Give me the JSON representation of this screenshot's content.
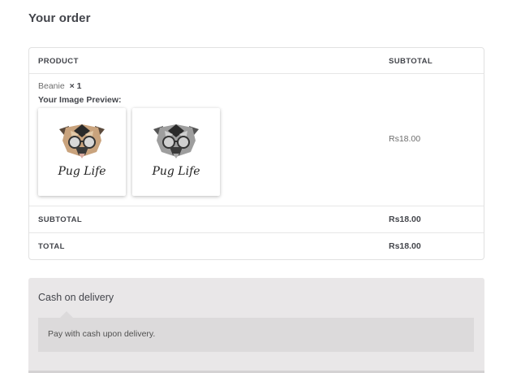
{
  "heading": "Your order",
  "table": {
    "col_product": "PRODUCT",
    "col_subtotal": "SUBTOTAL",
    "item": {
      "name": "Beanie",
      "qty": "× 1",
      "preview_label": "Your Image Preview:",
      "subtotal": "Rs18.00",
      "previews": [
        {
          "caption": "Pug Life",
          "style": "color"
        },
        {
          "caption": "Pug Life",
          "style": "grayscale"
        }
      ]
    },
    "subtotal_label": "SUBTOTAL",
    "subtotal_value": "Rs18.00",
    "total_label": "TOTAL",
    "total_value": "Rs18.00"
  },
  "payment": {
    "method_label": "Cash on delivery",
    "description": "Pay with cash upon delivery."
  }
}
